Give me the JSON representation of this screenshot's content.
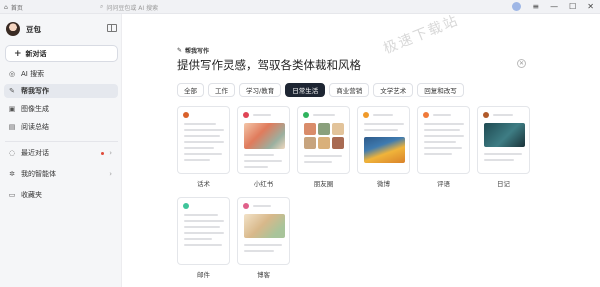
{
  "titlebar": {
    "home_label": "首页",
    "search_placeholder": "问问豆包或 AI 搜索"
  },
  "sidebar": {
    "user_name": "豆包",
    "new_chat_label": "新对话",
    "new_chat_shortcut": "⌘K",
    "items": [
      {
        "label": "AI 搜索",
        "icon": "ai-search-icon"
      },
      {
        "label": "帮我写作",
        "icon": "pen-icon",
        "active": true
      },
      {
        "label": "图像生成",
        "icon": "image-icon"
      },
      {
        "label": "阅读总结",
        "icon": "book-icon"
      }
    ],
    "recent_label": "最近对话",
    "agents_label": "我的智能体",
    "favorites_label": "收藏夹"
  },
  "main": {
    "small_title": "帮我写作",
    "title": "提供写作灵感，驾驭各类体裁和风格",
    "watermark": "极速下载站",
    "tabs": [
      "全部",
      "工作",
      "学习/教育",
      "日常生活",
      "商业营销",
      "文学艺术",
      "回复和改写"
    ],
    "active_tab": "日常生活",
    "cards": [
      {
        "label": "话术",
        "icon_color": "#d9612b"
      },
      {
        "label": "小红书",
        "icon_color": "#e04455"
      },
      {
        "label": "朋友圈",
        "icon_color": "#2fb35d"
      },
      {
        "label": "微博",
        "icon_color": "#f09a2a"
      },
      {
        "label": "评语",
        "icon_color": "#f07a3a"
      },
      {
        "label": "日记",
        "icon_color": "#b05a2a"
      },
      {
        "label": "邮件",
        "icon_color": "#3fc49a"
      },
      {
        "label": "博客",
        "icon_color": "#e0608a"
      }
    ]
  },
  "colors": {
    "active_tab_bg": "#1e2633",
    "sidebar_bg": "#f5f6f8"
  }
}
